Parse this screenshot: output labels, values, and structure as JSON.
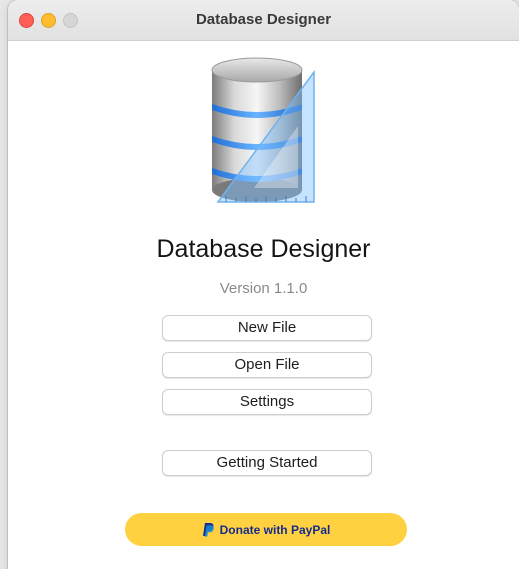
{
  "window": {
    "title": "Database Designer",
    "controls": [
      "close",
      "minimize",
      "maximize"
    ]
  },
  "app": {
    "logo_icon": "database-cylinder-ruler-icon",
    "name": "Database Designer",
    "version": "Version 1.1.0"
  },
  "buttons": {
    "new_file": "New File",
    "open_file": "Open File",
    "settings": "Settings",
    "getting_started": "Getting Started"
  },
  "donate": {
    "label": "Donate with PayPal",
    "icon": "paypal-icon",
    "color": "#ffd140"
  }
}
